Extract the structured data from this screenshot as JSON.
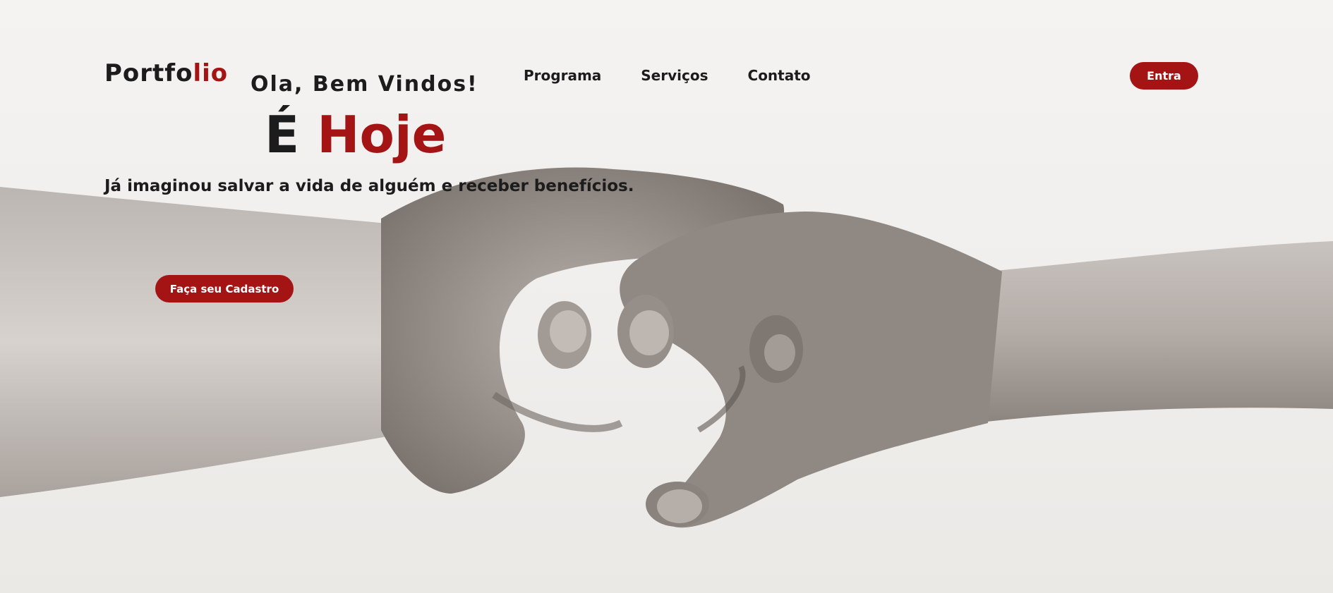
{
  "header": {
    "logo_main": "Portfo",
    "logo_accent": "lio",
    "greeting": "Ola, Bem Vindos!",
    "nav": [
      {
        "label": "Programa"
      },
      {
        "label": "Serviços"
      },
      {
        "label": "Contato"
      }
    ],
    "enter_label": "Entra"
  },
  "hero": {
    "headline_main": "É",
    "headline_accent": "Hoje",
    "tagline": "Já imaginou salvar a vida de alguém e receber benefícios.",
    "cta_label": "Faça seu Cadastro",
    "background_image": "clasped-hands-photo"
  },
  "colors": {
    "accent": "#a51414",
    "text": "#1c1c1c",
    "background": "#f2f0ee"
  }
}
